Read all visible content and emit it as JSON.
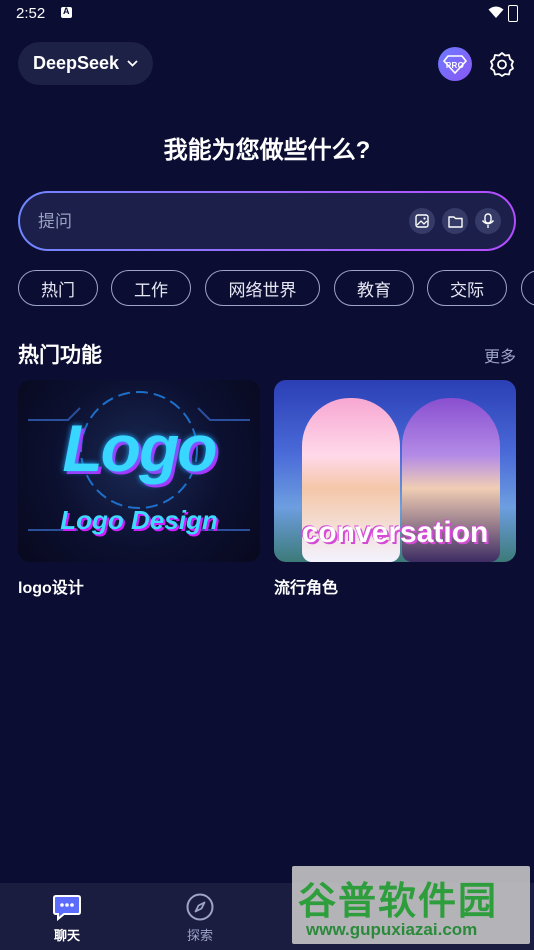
{
  "status": {
    "time": "2:52"
  },
  "header": {
    "model_name": "DeepSeek",
    "pro_label": "PRO"
  },
  "title": "我能为您做些什么?",
  "prompt": {
    "placeholder": "提问"
  },
  "chips": [
    "热门",
    "工作",
    "网络世界",
    "教育",
    "交际"
  ],
  "section": {
    "title": "热门功能",
    "more": "更多"
  },
  "cards": [
    {
      "title": "logo设计",
      "art_main": "Logo",
      "art_sub": "Logo Design"
    },
    {
      "title": "流行角色",
      "art_main": "conversation"
    }
  ],
  "nav": [
    {
      "label": "聊天",
      "active": true,
      "icon": "chat-bubble-icon"
    },
    {
      "label": "探索",
      "active": false,
      "icon": "compass-icon"
    }
  ],
  "watermark": {
    "big": "谷普软件园",
    "url": "www.gupuxiazai.com"
  },
  "colors": {
    "background": "#0b0d33",
    "accent": "#6f86ff",
    "accent2": "#b34cff"
  }
}
